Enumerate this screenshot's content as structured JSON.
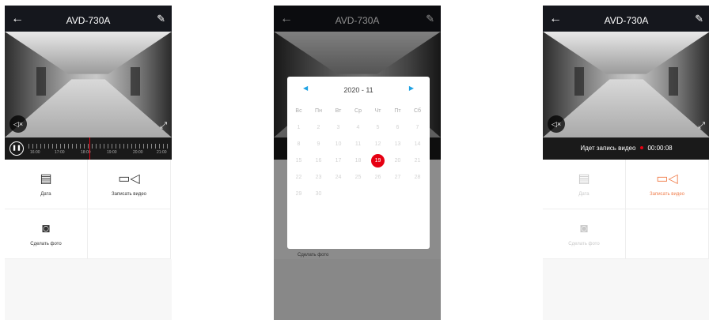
{
  "device_title": "AVD-730A",
  "icons": {
    "back": "arrow-left-icon",
    "edit": "pencil-icon",
    "mute": "speaker-muted-icon",
    "fullscreen": "expand-icon",
    "pause": "pause-icon",
    "date": "calendar-icon",
    "record": "video-camera-icon",
    "photo": "camera-icon"
  },
  "screen1": {
    "timeline_labels": [
      "16:00",
      "17:00",
      "18:00",
      "19:00",
      "20:00",
      "21:00"
    ],
    "buttons": {
      "date": "Дата",
      "record": "Записать видео",
      "photo": "Сделать фото"
    }
  },
  "screen2": {
    "calendar": {
      "month": "2020 - 11",
      "weekdays": [
        "Вс",
        "Пн",
        "Вт",
        "Ср",
        "Чт",
        "Пт",
        "Сб"
      ],
      "weeks": [
        [
          "1",
          "2",
          "3",
          "4",
          "5",
          "6",
          "7"
        ],
        [
          "8",
          "9",
          "10",
          "11",
          "12",
          "13",
          "14"
        ],
        [
          "15",
          "16",
          "17",
          "18",
          "19",
          "20",
          "21"
        ],
        [
          "22",
          "23",
          "24",
          "25",
          "26",
          "27",
          "28"
        ],
        [
          "29",
          "30",
          "",
          "",
          "",
          "",
          ""
        ]
      ],
      "selected": "19"
    },
    "photo_label": "Сделать фото"
  },
  "screen3": {
    "recording_text": "Идет запись видео",
    "recording_time": "00:00:08",
    "buttons": {
      "date": "Дата",
      "record": "Записать видео",
      "photo": "Сделать фото"
    }
  },
  "colors": {
    "accent_red": "#e60012",
    "calendar_arrow": "#1fa2e3",
    "record_active": "#f07d4b",
    "topbar": "#15171d"
  }
}
